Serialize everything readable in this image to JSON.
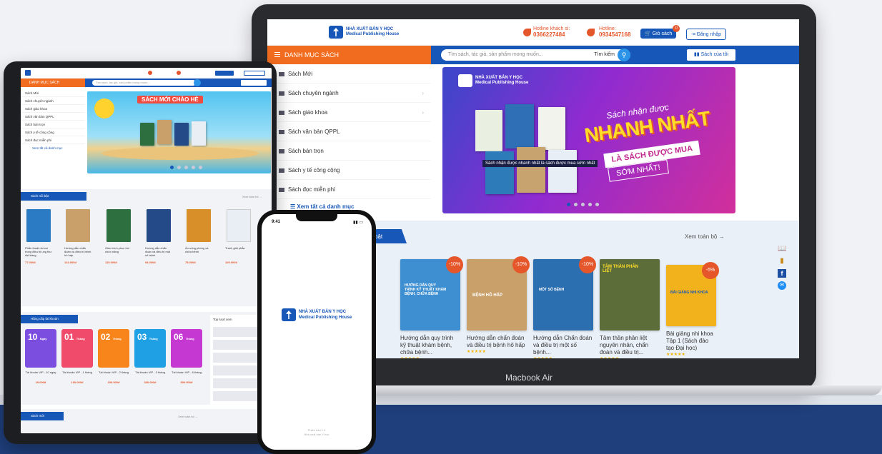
{
  "laptop": {
    "label": "Macbook Air",
    "header": {
      "logo_line1": "NHÀ XUẤT BẢN Y HỌC",
      "logo_line2": "Medical Publishing House",
      "hotline1_label": "Hotline khách sỉ:",
      "hotline1_number": "0366227484",
      "hotline2_label": "Hotline:",
      "hotline2_number": "0934547168",
      "cart_label": "Giỏ sách",
      "cart_count": "0",
      "login_label": "Đăng nhập"
    },
    "nav": {
      "category_label": "DANH MỤC SÁCH",
      "search_placeholder": "Tìm sách, tác giả, sản phẩm mong muốn...",
      "search_button": "Tìm kiếm",
      "my_books": "Sách của tôi"
    },
    "sidebar": {
      "items": [
        "Sách Mới",
        "Sách chuyên ngành",
        "Sách giáo khoa",
        "Sách văn bản QPPL",
        "Sách bán trọn",
        "Sách y tế công cộng",
        "Sách đọc miễn phí"
      ],
      "view_all": "Xem tất cả danh mục"
    },
    "banner": {
      "subtitle": "Sách nhận được",
      "headline": "NHANH NHẤT",
      "tag1": "LÀ SÁCH ĐƯỢC MUA",
      "tag2": "SỚM NHẤT!",
      "caption": "Sách nhận được nhanh nhất là sách được mua sớm nhất"
    },
    "featured": {
      "title": "bật",
      "see_all": "Xem toàn bộ →",
      "products": [
        {
          "name": "Hướng dẫn quy trình kỹ thuật khám bệnh, chữa bệnh...",
          "discount": "-10%",
          "cover_title": "HƯỚNG DẪN QUY TRÌNH KỸ THUẬT KHÁM BỆNH, CHỮA BỆNH",
          "color": "#3d8fd1"
        },
        {
          "name": "Hướng dẫn chẩn đoán và điều trị bệnh hô hấp",
          "discount": "-10%",
          "cover_title": "BỆNH HÔ HẤP",
          "color": "#c9a06a"
        },
        {
          "name": "Hướng dẫn Chẩn đoán và điều trị một số bệnh...",
          "discount": "-10%",
          "cover_title": "MỘT SỐ BỆNH",
          "color": "#2c6fb0"
        },
        {
          "name": "Tâm thần phân liệt nguyên nhân, chẩn đoán và điều trị...",
          "discount": "",
          "cover_title": "TÂM THẦN PHÂN LIỆT",
          "color": "#5c6d3a"
        },
        {
          "name": "Bài giảng nhi khoa Tập 1 (Sách đào tạo Đại học)",
          "discount": "-5%",
          "cover_title": "BÀI GIẢNG NHI KHOA",
          "color": "#f2b21b"
        }
      ]
    }
  },
  "tablet": {
    "category_label": "DANH MỤC SÁCH",
    "search_placeholder": "Tìm sách, tác giả, sản phẩm mong muốn...",
    "sidebar_items": [
      "Sách Mới",
      "Sách chuyên ngành",
      "Sách giáo khoa",
      "Sách văn bản QPPL",
      "Sách bán trọn",
      "Sách y tế công cộng",
      "Sách đọc miễn phí"
    ],
    "view_all": "Xem tất cả danh mục",
    "banner_title": "SÁCH MỚI CHÀO HÈ",
    "section1_title": "Sách nổi bật",
    "section1_more": "Xem toàn bộ →",
    "books": [
      {
        "name": "Phẫu thuật nội soi trong điều trị ung thư đại tràng",
        "price": "77.000đ",
        "color": "#2a7bc4"
      },
      {
        "name": "Hướng dẫn chẩn đoán và điều trị bệnh hô hấp",
        "price": "124.000đ",
        "color": "#c9a06a"
      },
      {
        "name": "Giáo trình phục hồi chức năng",
        "price": "115.000đ",
        "color": "#2d6f3f"
      },
      {
        "name": "Hướng dẫn chẩn đoán và điều trị một số bệnh",
        "price": "94.000đ",
        "color": "#244b88"
      },
      {
        "name": "Ẩn uống phòng và chữa bệnh",
        "price": "75.000đ",
        "color": "#d88f2a"
      },
      {
        "name": "Tranh giải phẫu",
        "price": "100.000đ",
        "color": "#e9eef5"
      }
    ],
    "section2_title": "Hằng cấp tài khoản",
    "vip": [
      {
        "num": "10",
        "unit": "Ngày",
        "name": "Tài khoản VIP - 10 ngày",
        "price": "29.000đ",
        "color": "#7b4ee0"
      },
      {
        "num": "01",
        "unit": "Tháng",
        "name": "Tài khoản VIP - 1 tháng",
        "price": "100.000đ",
        "color": "#f04b6a"
      },
      {
        "num": "02",
        "unit": "Tháng",
        "name": "Tài khoản VIP - 2 tháng",
        "price": "190.000đ",
        "color": "#f7851b"
      },
      {
        "num": "03",
        "unit": "Tháng",
        "name": "Tài khoản VIP - 3 tháng",
        "price": "300.000đ",
        "color": "#1fa0e5"
      },
      {
        "num": "06",
        "unit": "Tháng",
        "name": "Tài khoản VIP - 6 tháng",
        "price": "500.000đ",
        "color": "#c538d1"
      }
    ],
    "top_title": "Top lượt xem",
    "section3_title": "Sách mới",
    "section3_more": "Xem toàn bộ →"
  },
  "phone": {
    "time": "9:41",
    "logo_line1": "NHÀ XUẤT BẢN Y HỌC",
    "logo_line2": "Medical Publishing House",
    "version": "Phiên bản 1.0",
    "publisher": "Nhà xuất bản Y học"
  }
}
